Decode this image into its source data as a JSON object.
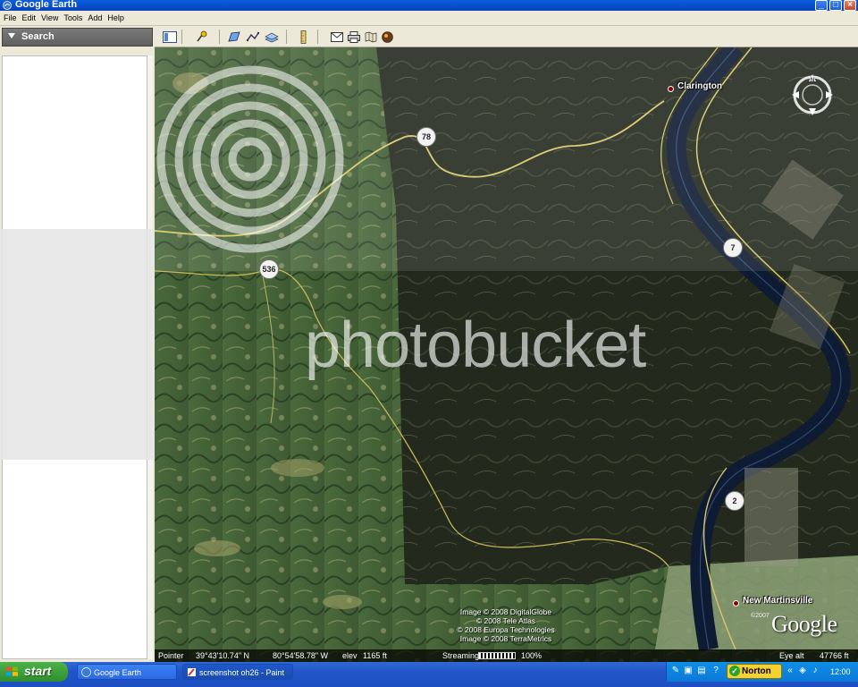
{
  "window": {
    "title": "Google Earth",
    "minimize_glyph": "_",
    "maximize_glyph": "□",
    "close_glyph": "×"
  },
  "menu": [
    "File",
    "Edit",
    "View",
    "Tools",
    "Add",
    "Help"
  ],
  "sidebar": {
    "search_label": "Search"
  },
  "toolbar": {
    "icons": [
      "sidebar-toggle-icon",
      "placemark-icon",
      "polygon-icon",
      "path-icon",
      "image-overlay-icon",
      "ruler-icon",
      "email-icon",
      "print-icon",
      "show-in-maps-icon",
      "sky-icon"
    ]
  },
  "map": {
    "places": {
      "clarington": "Clarington",
      "new_martinsville": "New Martinsville"
    },
    "route_shields": {
      "r78": "78",
      "r536": "536",
      "r7": "7",
      "r2": "2"
    },
    "credits": [
      "Image © 2008 DigitalGlobe",
      "© 2008 Tele Atlas",
      "© 2008 Europa Technologies",
      "Image © 2008 TerraMetrics"
    ],
    "logo": "Google",
    "copyright_year": "©2007",
    "compass_label": "N"
  },
  "statusbar": {
    "pointer_label": "Pointer",
    "latitude": "39°43'10.74\" N",
    "longitude": "80°54'58.78\" W",
    "elev_label": "elev",
    "elev_value": "1165 ft",
    "streaming_label": "Streaming",
    "streaming_percent": "100%",
    "eye_alt_label": "Eye alt",
    "eye_alt_value": "47766 ft"
  },
  "watermark": {
    "text": "photobucket"
  },
  "taskbar": {
    "start_label": "start",
    "items": [
      {
        "label": "Google Earth",
        "active": false
      },
      {
        "label": "screenshot oh26 - Paint",
        "active": true
      }
    ],
    "norton_label": "Norton",
    "clock": "12:00 PM"
  },
  "colors": {
    "titlebar": "#0842b8",
    "chrome": "#ece9d8",
    "river": "#0f1b33",
    "road": "#d8c86a",
    "taskbar": "#2155c7",
    "start_green": "#3b9c38"
  }
}
